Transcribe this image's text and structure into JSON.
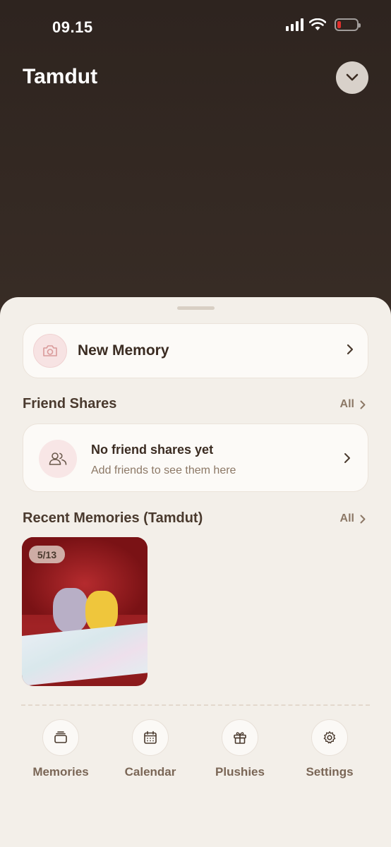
{
  "status_bar": {
    "time": "09.15"
  },
  "header": {
    "title": "Tamdut"
  },
  "new_memory": {
    "label": "New Memory"
  },
  "friend_shares": {
    "title": "Friend Shares",
    "see_all": "All",
    "empty_title": "No friend shares yet",
    "empty_subtitle": "Add friends to see them here"
  },
  "recent_memories": {
    "title": "Recent Memories (Tamdut)",
    "see_all": "All",
    "items": [
      {
        "date": "5/13"
      }
    ]
  },
  "tabs": [
    {
      "label": "Memories",
      "icon": "stack-icon"
    },
    {
      "label": "Calendar",
      "icon": "calendar-icon"
    },
    {
      "label": "Plushies",
      "icon": "gift-icon"
    },
    {
      "label": "Settings",
      "icon": "gear-icon"
    }
  ],
  "colors": {
    "background_dark": "#2e241f",
    "sheet": "#f3efe9",
    "accent_pink": "#f7e3e3",
    "text_primary": "#3b2c22",
    "text_secondary": "#8c7866"
  }
}
